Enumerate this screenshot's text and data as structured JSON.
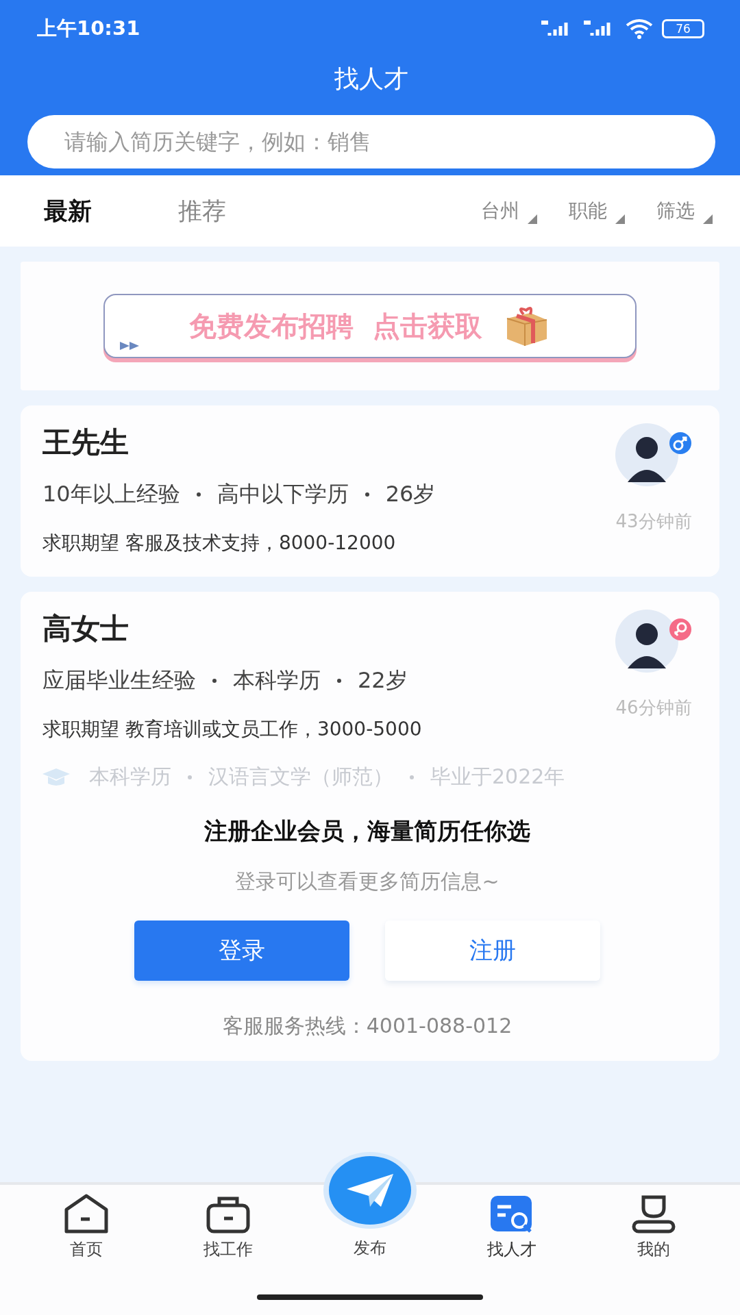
{
  "status_bar": {
    "time": "上午10:31",
    "battery": "76"
  },
  "header": {
    "title": "找人才"
  },
  "search": {
    "placeholder": "请输入简历关键字，例如：销售"
  },
  "tabs": [
    {
      "label": "最新",
      "selected": true
    },
    {
      "label": "推荐",
      "selected": false
    }
  ],
  "filters": [
    "台州",
    "职能",
    "筛选"
  ],
  "banner": {
    "text": "免费发布招聘  点击获取"
  },
  "resumes": [
    {
      "name": "王先生",
      "kind": "male",
      "meta": [
        "10年以上经验",
        "高中以下学历",
        "26岁"
      ],
      "expectation": "求职期望 客服及技术支持，8000-12000",
      "time": "43分钟前"
    },
    {
      "name": "高女士",
      "kind": "female",
      "meta": [
        "应届毕业生经验",
        "本科学历",
        "22岁"
      ],
      "expectation": "求职期望 教育培训或文员工作，3000-5000",
      "time": "46分钟前",
      "education": [
        "本科学历",
        "汉语言文学（师范）",
        "毕业于2022年"
      ],
      "prompt": {
        "title": "注册企业会员，海量简历任你选",
        "subtitle": "登录可以查看更多简历信息~",
        "buttons": [
          {
            "label": "登录",
            "kind": "primary"
          },
          {
            "label": "注册",
            "kind": "secondary"
          }
        ],
        "hotline": "客服服务热线：4001-088-012"
      }
    }
  ],
  "nav": [
    {
      "label": "首页",
      "kind": "home",
      "selected": false
    },
    {
      "label": "找工作",
      "kind": "jobs",
      "selected": false
    },
    {
      "label": "发布",
      "kind": "post",
      "selected": false
    },
    {
      "label": "找人才",
      "kind": "talent",
      "selected": true
    },
    {
      "label": "我的",
      "kind": "me",
      "selected": false
    }
  ]
}
